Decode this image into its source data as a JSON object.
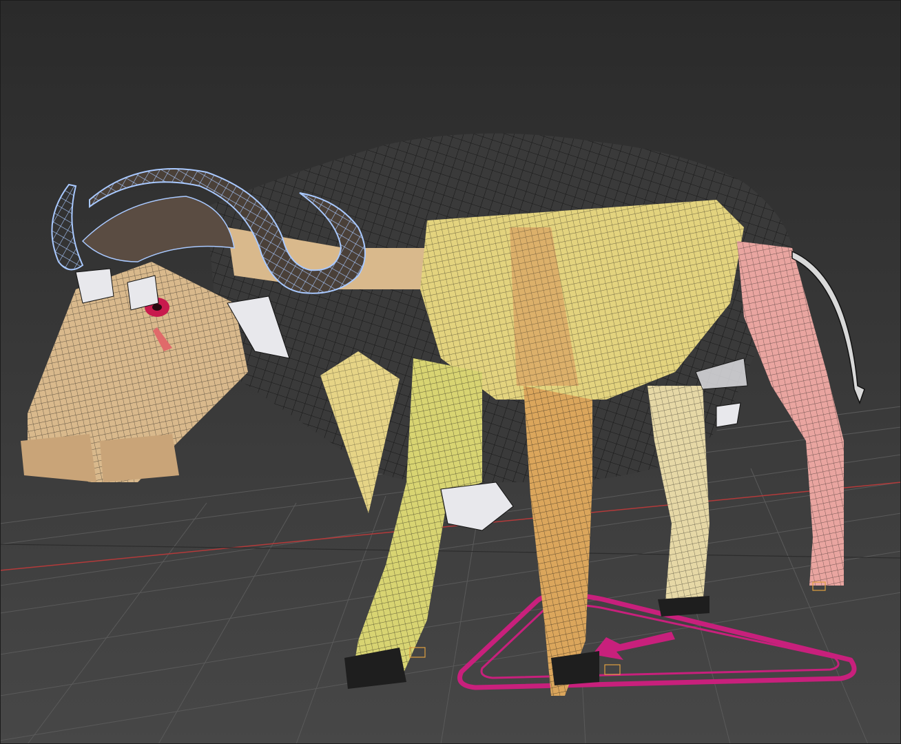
{
  "viewport": {
    "background_top": "#2a2a2a",
    "background_bottom": "#474747",
    "grid_color": "#5a5a5a",
    "x_axis_color": "#b43a3a",
    "wire_color": "#111111",
    "horn_wire_color": "#a9c9ff"
  },
  "scene": {
    "object": "buffalo-rig",
    "bone_colors": {
      "head": "#d9b98c",
      "body": "#e3d37e",
      "front_leg": "#d8d472",
      "rear_leg": "#e8b292",
      "tail_leg": "#e9a5a0",
      "horn_shell": "#e8e8ec",
      "skin": "#3a3a3a"
    },
    "controller": {
      "shape": "triangle-arrow",
      "color": "#c8207c"
    },
    "eye_color": "#c81a4d"
  }
}
